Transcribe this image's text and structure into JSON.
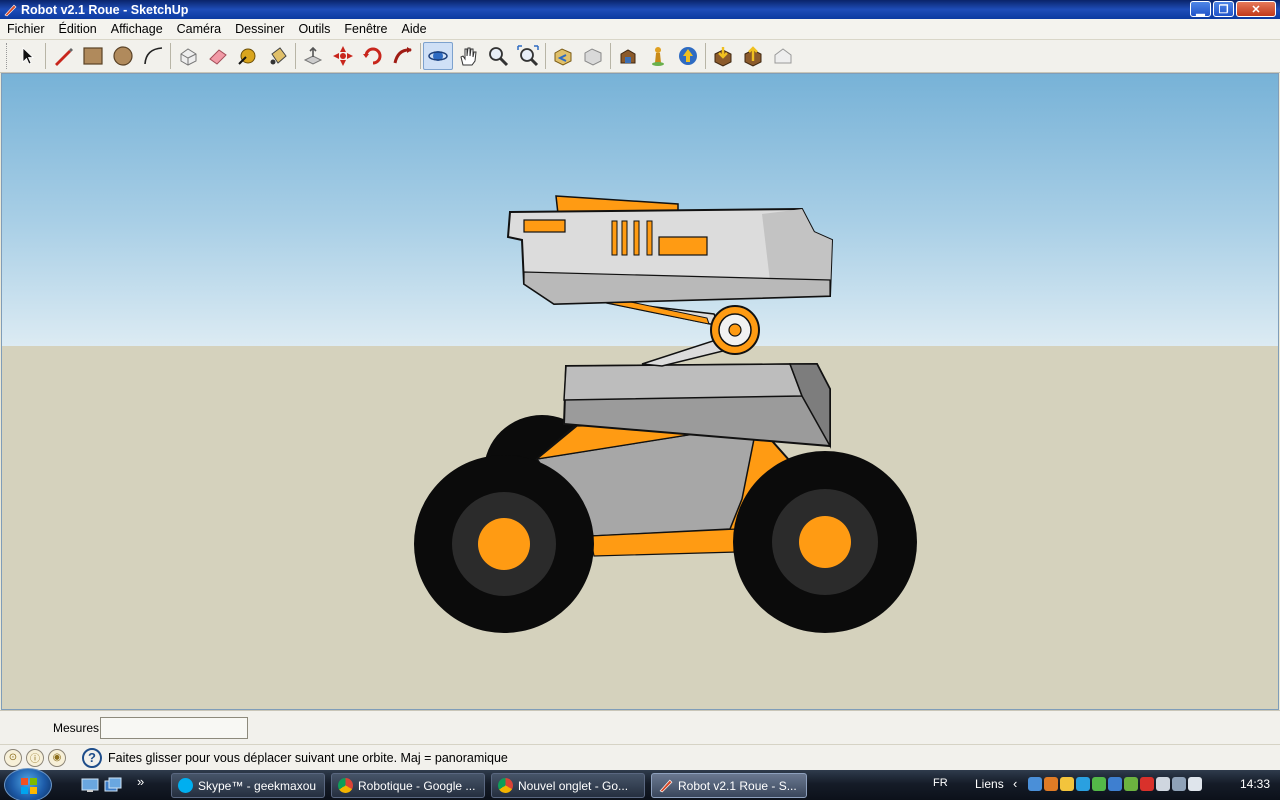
{
  "window": {
    "title": "Robot v2.1 Roue - SketchUp",
    "minimize_glyph": "▁",
    "maximize_glyph": "❐",
    "close_glyph": "✕"
  },
  "menu": {
    "items": [
      "Fichier",
      "Édition",
      "Affichage",
      "Caméra",
      "Dessiner",
      "Outils",
      "Fenêtre",
      "Aide"
    ]
  },
  "toolbar": {
    "tools": [
      "select-tool-icon",
      "pencil-line-icon",
      "rectangle-icon",
      "circle-icon",
      "arc-icon",
      "make-component-icon",
      "eraser-icon",
      "tape-measure-icon",
      "paint-bucket-icon",
      "push-pull-icon",
      "move-icon",
      "rotate-icon",
      "follow-me-icon",
      "orbit-icon",
      "pan-icon",
      "zoom-icon",
      "zoom-extents-icon",
      "previous-view-icon",
      "next-view-icon",
      "3d-warehouse-icon",
      "position-camera-icon",
      "walk-icon",
      "get-models-icon",
      "share-model-icon",
      "share-component-icon"
    ],
    "active_tool": "orbit-icon",
    "colors": {
      "active_bg": "#cfe0f6"
    }
  },
  "viewport": {
    "colors": {
      "sky_top": "#77b2d7",
      "sky_horizon": "#dcebf3",
      "ground": "#d5d2bd",
      "model_orange": "#ff9b13",
      "model_gray": "#a7a7a7",
      "model_light": "#dcdcdc",
      "tire": "#0b0b0b"
    }
  },
  "measurements": {
    "label": "Mesures",
    "value": ""
  },
  "status": {
    "message": "Faites glisser pour vous déplacer suivant une orbite.  Maj = panoramique"
  },
  "taskbar": {
    "tasks": [
      {
        "label": "Skype™ - geekmaxou",
        "icon": "skype-icon",
        "color": "#00aff0"
      },
      {
        "label": "Robotique - Google ...",
        "icon": "chrome-icon",
        "color": "#e8b019"
      },
      {
        "label": "Nouvel onglet - Go...",
        "icon": "chrome-icon",
        "color": "#e8b019"
      },
      {
        "label": "Robot v2.1 Roue - S...",
        "icon": "sketchup-icon",
        "color": "#d84b2a",
        "active": true
      }
    ],
    "quicklaunch_more": "»",
    "language": "FR",
    "links_label": "Liens",
    "links_chevron": "‹",
    "clock": "14:33"
  }
}
